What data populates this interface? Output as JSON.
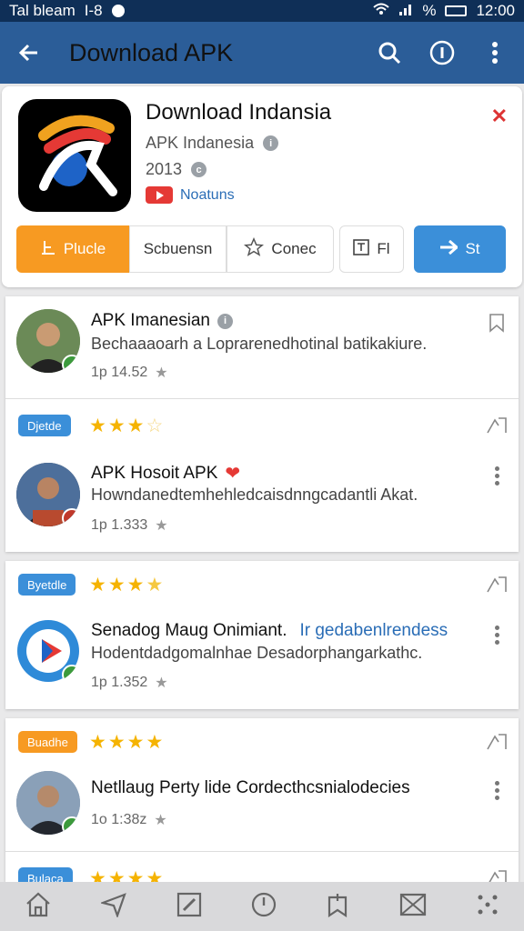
{
  "status": {
    "carrier": "Tal bleam",
    "signal_text": "I-8",
    "percent": "%",
    "time": "12:00"
  },
  "appbar": {
    "title": "Download APK",
    "icons": [
      "back-arrow-icon",
      "search-icon",
      "info-circle-icon",
      "kebab-icon"
    ]
  },
  "app": {
    "name": "Download Indansia",
    "developer": "APK Indanesia",
    "year": "2013",
    "video_label": "Noatuns",
    "buttons": {
      "primary": "Plucle",
      "screens": "Scbuensn",
      "corner": "Conec",
      "fi": "Fl",
      "share": "St"
    }
  },
  "posts": [
    {
      "author": "APK Imanesian",
      "text": "Bechaaaoarh a Loprarenedhotinal batikakiure.",
      "time": "1p 14.52"
    },
    {
      "badge": "Djetde",
      "rating": 3.5,
      "author": "APK Hosoit APK",
      "emoji": "❤",
      "text": "Howndanedtemhehledcaisdnngcadantli Akat.",
      "time": "1p 1.333"
    },
    {
      "badge": "Byetdle",
      "rating": 4.5,
      "author": "Senadog Maug Onimiant.",
      "link": "Ir gedabenlrendess",
      "text": "Hodentdadgomalnhae Desadorphangarkathc.",
      "time": "1p 1.352"
    },
    {
      "badge": "Buadhe",
      "rating": 4,
      "author": "Netllaug Perty lide Cordecthcsnialodecies",
      "time": "1o 1:38z"
    },
    {
      "badge": "Bulaca",
      "rating": 4
    }
  ],
  "colors": {
    "appbar": "#2b5d98",
    "status": "#0f2f57",
    "orange": "#f79a22",
    "blue": "#3b8fd9",
    "pill_blue": "#3b8fd9",
    "pill_orange": "#f79a22",
    "star": "#f5b301"
  }
}
